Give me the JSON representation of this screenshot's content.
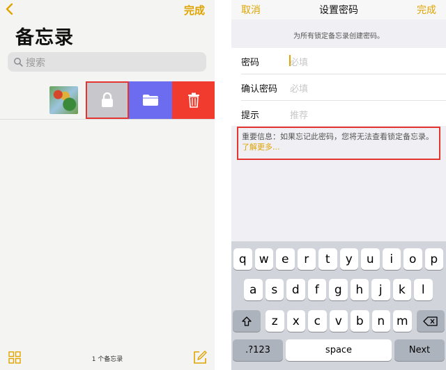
{
  "left": {
    "done_label": "完成",
    "title": "备忘录",
    "search_placeholder": "搜索",
    "note_count": "1 个备忘录"
  },
  "right": {
    "cancel_label": "取消",
    "title": "设置密码",
    "done_label": "完成",
    "note": "为所有锁定备忘录创建密码。",
    "fields": [
      {
        "label": "密码",
        "placeholder": "必填"
      },
      {
        "label": "确认密码",
        "placeholder": "必填"
      },
      {
        "label": "提示",
        "placeholder": "推荐"
      }
    ],
    "warning_text": "重要信息：如果忘记此密码，您将无法查看锁定备忘录。",
    "warning_link": "了解更多..."
  },
  "keyboard": {
    "row1": [
      "q",
      "w",
      "e",
      "r",
      "t",
      "y",
      "u",
      "i",
      "o",
      "p"
    ],
    "row2": [
      "a",
      "s",
      "d",
      "f",
      "g",
      "h",
      "j",
      "k",
      "l"
    ],
    "row3": [
      "z",
      "x",
      "c",
      "v",
      "b",
      "n",
      "m"
    ],
    "numbers_label": ".?123",
    "space_label": "space",
    "next_label": "Next"
  },
  "colors": {
    "accent": "#e0a400",
    "lock_action": "#c7c7cc",
    "move_action": "#6c6cf0",
    "delete_action": "#f23b2f",
    "highlight": "#e3342f"
  }
}
